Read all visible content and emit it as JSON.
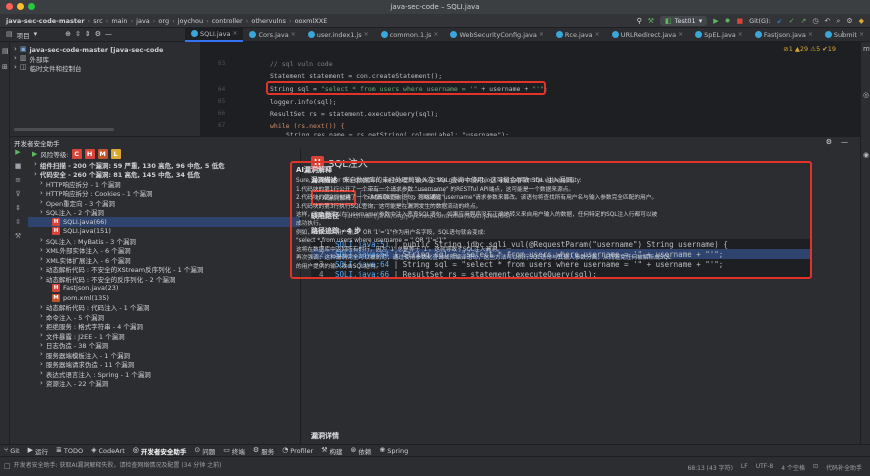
{
  "window": {
    "title": "java-sec-code – SQLI.java"
  },
  "breadcrumbs": [
    "java-sec-code-master",
    "src",
    "main",
    "java",
    "org",
    "joychou",
    "controller",
    "othervulns",
    "ooxmlXXE"
  ],
  "navbar": {
    "run_config": "Test01",
    "git_label": "Git(G):"
  },
  "project_panel": {
    "label": "项目",
    "items": [
      {
        "label": "java-sec-code-master [java-sec-code"
      },
      {
        "label": "外部库"
      },
      {
        "label": "临时文件和控制台"
      }
    ]
  },
  "editor_tabs": [
    {
      "label": "SQLI.java",
      "active": true
    },
    {
      "label": "Cors.java"
    },
    {
      "label": "user.index1.js"
    },
    {
      "label": "common.1.js"
    },
    {
      "label": "WebSecurityConfig.java"
    },
    {
      "label": "Rce.java"
    },
    {
      "label": "URLRedirect.java"
    },
    {
      "label": "SpEL.java"
    },
    {
      "label": "Fastjson.java"
    },
    {
      "label": "Submit"
    }
  ],
  "editor": {
    "inspection_summary": "⊘1 ▲29 ⚠5 ✔19",
    "line_numbers": [
      "63",
      "",
      "64",
      "65",
      "66",
      "67",
      ""
    ],
    "lines": [
      {
        "text": "// sql vuln code",
        "kind": "comment"
      },
      {
        "text": "Statement statement = con.createStatement();",
        "kind": "plain"
      },
      {
        "prefix": "String sql = ",
        "str1": "\"select * from users where username = '\"",
        "mid": " + username + ",
        "str2": "\"'\"",
        "suffix": ";",
        "kind": "sql"
      },
      {
        "text": "logger.info(sql);",
        "kind": "plain"
      },
      {
        "text": "ResultSet rs = statement.executeQuery(sql);",
        "kind": "plain"
      },
      {
        "text": "while (rs.next()) {",
        "kind": "plain"
      },
      {
        "text": "String res_name = rs.getString( columnLabel: \"username\");",
        "kind": "plain"
      }
    ]
  },
  "security_panel": {
    "title": "开发者安全助手",
    "risk_label": "风险等级:",
    "risk_badges": [
      "C",
      "H",
      "M",
      "L"
    ],
    "tree": [
      {
        "label": "组件扫描 - 200 个漏洞: 59 严重, 130 高危, 96 中危, 5 低危",
        "indent": 1,
        "bold": true
      },
      {
        "label": "代码安全 - 260 个漏洞: 81 高危, 145 中危, 34 低危",
        "indent": 1,
        "bold": true
      },
      {
        "label": "HTTP响应拆分 - 1 个漏洞",
        "indent": 2
      },
      {
        "label": "HTTP响应拆分 : Cookies - 1 个漏洞",
        "indent": 2
      },
      {
        "label": "Open重定向 - 3 个漏洞",
        "indent": 2
      },
      {
        "label": "SQL注入 - 2 个漏洞",
        "indent": 2
      },
      {
        "label": "SQLI.java(66)",
        "indent": 4,
        "badge": "H",
        "selected": true
      },
      {
        "label": "SQLI.java(151)",
        "indent": 4,
        "badge": "H"
      },
      {
        "label": "SQL注入 : MyBatis - 3 个漏洞",
        "indent": 2
      },
      {
        "label": "XML外部实体注入 - 6 个漏洞",
        "indent": 2
      },
      {
        "label": "XML实体扩展注入 - 6 个漏洞",
        "indent": 2
      },
      {
        "label": "动态解析代码 : 不安全的XStream反序列化 - 1 个漏洞",
        "indent": 2
      },
      {
        "label": "动态解析代码 : 不安全的反序列化 - 2 个漏洞",
        "indent": 2
      },
      {
        "label": "Fastjson.java(23)",
        "indent": 4,
        "badge": "H"
      },
      {
        "label": "pom.xml(135)",
        "indent": 4,
        "badge": "M"
      },
      {
        "label": "动态解析代码 : 代码注入 - 1 个漏洞",
        "indent": 2
      },
      {
        "label": "命令注入 - 5 个漏洞",
        "indent": 2
      },
      {
        "label": "拒绝服务 : 格式字符串 - 4 个漏洞",
        "indent": 2
      },
      {
        "label": "文件暴露 : J2EE - 1 个漏洞",
        "indent": 2
      },
      {
        "label": "日志伪造 - 38 个漏洞",
        "indent": 2
      },
      {
        "label": "服务器端模板注入 - 1 个漏洞",
        "indent": 2
      },
      {
        "label": "服务器端请求伪造 - 11 个漏洞",
        "indent": 2
      },
      {
        "label": "表达式语言注入 : Spring - 1 个漏洞",
        "indent": 2
      },
      {
        "label": "资源注入 - 22 个漏洞",
        "indent": 2
      }
    ]
  },
  "details": {
    "badge": "H",
    "title": "SQL注入",
    "desc_label": "漏洞描述",
    "desc_text": "来自数据库的未经处理的输入在 SQL 查询中使用。这可能会导致 SQL 注入漏洞。",
    "buttons": [
      "AI漏洞解释",
      "AI漏洞修复",
      "忽略缺陷"
    ],
    "path_label": "缺陷路径",
    "path_value": "/src/main/java/org/joychou/controller/SQLI.java(66)",
    "trace_label": "路径追踪 - 4 步",
    "trace": [
      {
        "num": "1",
        "file": "SQLI.java:51",
        "code": "public String jdbc_sqli_vul(@RequestParam(\"username\") String username) {"
      },
      {
        "num": "2",
        "file": "SQLI.java:64",
        "code": "String sql = \"select * from users where username = '\" + username + \"'\";",
        "selected": true
      },
      {
        "num": "3",
        "file": "SQLI.java:64",
        "code": "String sql = \"select * from users where username = '\" + username + \"'\";"
      },
      {
        "num": "4",
        "file": "SQLI.java:66",
        "code": "ResultSet rs = statement.executeQuery(sql);"
      }
    ],
    "ai_title": "AI漏洞解释",
    "ai_lines": [
      "Sure, to answer this question, we need to look at the given code block and explain the vulnerability:",
      "1.代码块的第1行公开了一个带有一个请求参数 \"username\" 的RESTful API端点，这可能是一个数据来源点。",
      "2.代码块的第2行创建了一个动态SQL查询语句，可以通过\"username\"请求参数来篡改。该语句将查找所有用户名与输入参数完全匹配的用户。",
      "3.代码块的第3行执行SQL查询，这可能是在漏洞发生的数据流动的终点。",
      "这样，攻击者可以在'username'参数中注入恶意SQL语句。如果应用程序没有正确地转义来自用户输入的数据，任何特定的SQL注入行都可以被",
      "成功执行。",
      "例如，如果一个用户输入\" OR '1'='1\"作为用户名字段，SQL语句就会变成:",
      "\"select * from users where username = '' OR '1'='1'\"",
      "这将在数据库中返回所有的行，因为 '1' 总是等于 '1'。这就导致了SQL注入漏洞。",
      "再次强调，这种漏洞完全可以被防范，通过使用参数化查询或预编译语句，这些方法可以执行SQL语句与其输入参数分离，从而避免任何被解析成SQL",
      "的用户提供的输入攻击SQL结构。"
    ],
    "detail_label": "漏洞详情"
  },
  "tool_windows": [
    "Git",
    "运行",
    "TODO",
    "CodeArt",
    "开发者安全助手",
    "问题",
    "终端",
    "服务",
    "Profiler",
    "构建",
    "依赖",
    "Spring"
  ],
  "status": {
    "message": "开发者安全助手: 获取AI漏洞解释失败，请检查网络情况及配置 (34 分钟 之前)",
    "position": "68:13 (43 字符)",
    "line_sep": "LF",
    "encoding": "UTF-8",
    "indent": "4 个空格",
    "plugin": "代码补全助手"
  },
  "colors": {
    "accent": "#3574f0",
    "highlight": "#e0332a",
    "badge_high": "#d9443a",
    "badge_low": "#d9a934"
  }
}
